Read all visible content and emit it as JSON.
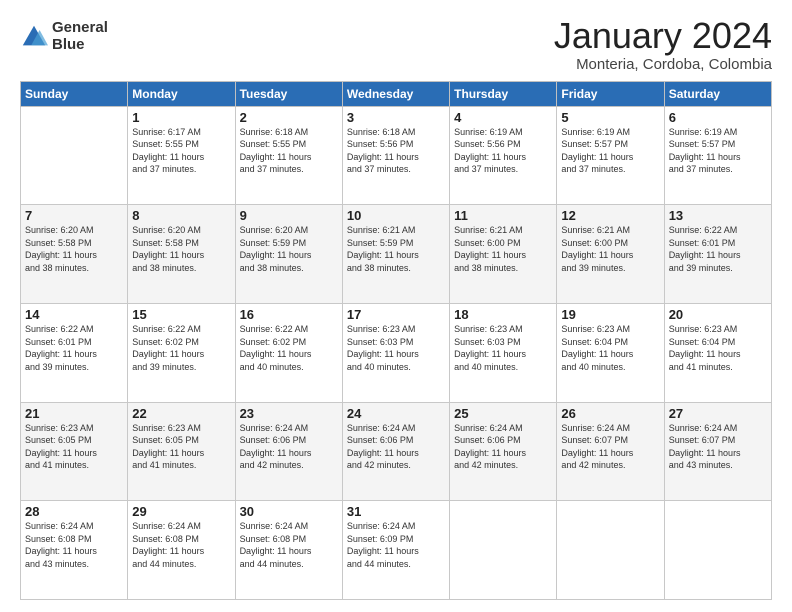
{
  "logo": {
    "line1": "General",
    "line2": "Blue"
  },
  "title": "January 2024",
  "subtitle": "Monteria, Cordoba, Colombia",
  "weekdays": [
    "Sunday",
    "Monday",
    "Tuesday",
    "Wednesday",
    "Thursday",
    "Friday",
    "Saturday"
  ],
  "weeks": [
    [
      {
        "day": "",
        "info": ""
      },
      {
        "day": "1",
        "info": "Sunrise: 6:17 AM\nSunset: 5:55 PM\nDaylight: 11 hours\nand 37 minutes."
      },
      {
        "day": "2",
        "info": "Sunrise: 6:18 AM\nSunset: 5:55 PM\nDaylight: 11 hours\nand 37 minutes."
      },
      {
        "day": "3",
        "info": "Sunrise: 6:18 AM\nSunset: 5:56 PM\nDaylight: 11 hours\nand 37 minutes."
      },
      {
        "day": "4",
        "info": "Sunrise: 6:19 AM\nSunset: 5:56 PM\nDaylight: 11 hours\nand 37 minutes."
      },
      {
        "day": "5",
        "info": "Sunrise: 6:19 AM\nSunset: 5:57 PM\nDaylight: 11 hours\nand 37 minutes."
      },
      {
        "day": "6",
        "info": "Sunrise: 6:19 AM\nSunset: 5:57 PM\nDaylight: 11 hours\nand 37 minutes."
      }
    ],
    [
      {
        "day": "7",
        "info": "Sunrise: 6:20 AM\nSunset: 5:58 PM\nDaylight: 11 hours\nand 38 minutes."
      },
      {
        "day": "8",
        "info": "Sunrise: 6:20 AM\nSunset: 5:58 PM\nDaylight: 11 hours\nand 38 minutes."
      },
      {
        "day": "9",
        "info": "Sunrise: 6:20 AM\nSunset: 5:59 PM\nDaylight: 11 hours\nand 38 minutes."
      },
      {
        "day": "10",
        "info": "Sunrise: 6:21 AM\nSunset: 5:59 PM\nDaylight: 11 hours\nand 38 minutes."
      },
      {
        "day": "11",
        "info": "Sunrise: 6:21 AM\nSunset: 6:00 PM\nDaylight: 11 hours\nand 38 minutes."
      },
      {
        "day": "12",
        "info": "Sunrise: 6:21 AM\nSunset: 6:00 PM\nDaylight: 11 hours\nand 39 minutes."
      },
      {
        "day": "13",
        "info": "Sunrise: 6:22 AM\nSunset: 6:01 PM\nDaylight: 11 hours\nand 39 minutes."
      }
    ],
    [
      {
        "day": "14",
        "info": "Sunrise: 6:22 AM\nSunset: 6:01 PM\nDaylight: 11 hours\nand 39 minutes."
      },
      {
        "day": "15",
        "info": "Sunrise: 6:22 AM\nSunset: 6:02 PM\nDaylight: 11 hours\nand 39 minutes."
      },
      {
        "day": "16",
        "info": "Sunrise: 6:22 AM\nSunset: 6:02 PM\nDaylight: 11 hours\nand 40 minutes."
      },
      {
        "day": "17",
        "info": "Sunrise: 6:23 AM\nSunset: 6:03 PM\nDaylight: 11 hours\nand 40 minutes."
      },
      {
        "day": "18",
        "info": "Sunrise: 6:23 AM\nSunset: 6:03 PM\nDaylight: 11 hours\nand 40 minutes."
      },
      {
        "day": "19",
        "info": "Sunrise: 6:23 AM\nSunset: 6:04 PM\nDaylight: 11 hours\nand 40 minutes."
      },
      {
        "day": "20",
        "info": "Sunrise: 6:23 AM\nSunset: 6:04 PM\nDaylight: 11 hours\nand 41 minutes."
      }
    ],
    [
      {
        "day": "21",
        "info": "Sunrise: 6:23 AM\nSunset: 6:05 PM\nDaylight: 11 hours\nand 41 minutes."
      },
      {
        "day": "22",
        "info": "Sunrise: 6:23 AM\nSunset: 6:05 PM\nDaylight: 11 hours\nand 41 minutes."
      },
      {
        "day": "23",
        "info": "Sunrise: 6:24 AM\nSunset: 6:06 PM\nDaylight: 11 hours\nand 42 minutes."
      },
      {
        "day": "24",
        "info": "Sunrise: 6:24 AM\nSunset: 6:06 PM\nDaylight: 11 hours\nand 42 minutes."
      },
      {
        "day": "25",
        "info": "Sunrise: 6:24 AM\nSunset: 6:06 PM\nDaylight: 11 hours\nand 42 minutes."
      },
      {
        "day": "26",
        "info": "Sunrise: 6:24 AM\nSunset: 6:07 PM\nDaylight: 11 hours\nand 42 minutes."
      },
      {
        "day": "27",
        "info": "Sunrise: 6:24 AM\nSunset: 6:07 PM\nDaylight: 11 hours\nand 43 minutes."
      }
    ],
    [
      {
        "day": "28",
        "info": "Sunrise: 6:24 AM\nSunset: 6:08 PM\nDaylight: 11 hours\nand 43 minutes."
      },
      {
        "day": "29",
        "info": "Sunrise: 6:24 AM\nSunset: 6:08 PM\nDaylight: 11 hours\nand 44 minutes."
      },
      {
        "day": "30",
        "info": "Sunrise: 6:24 AM\nSunset: 6:08 PM\nDaylight: 11 hours\nand 44 minutes."
      },
      {
        "day": "31",
        "info": "Sunrise: 6:24 AM\nSunset: 6:09 PM\nDaylight: 11 hours\nand 44 minutes."
      },
      {
        "day": "",
        "info": ""
      },
      {
        "day": "",
        "info": ""
      },
      {
        "day": "",
        "info": ""
      }
    ]
  ]
}
